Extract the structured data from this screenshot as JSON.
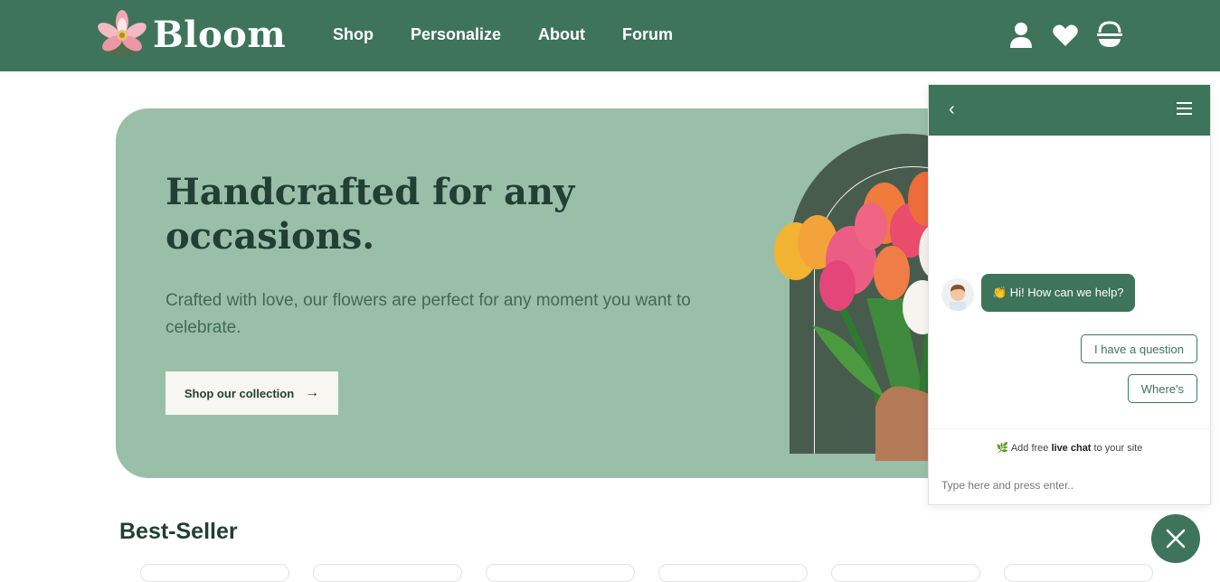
{
  "brand": {
    "name": "Bloom"
  },
  "nav": {
    "items": [
      "Shop",
      "Personalize",
      "About",
      "Forum"
    ]
  },
  "nav_icons": [
    "user-icon",
    "heart-icon",
    "basket-icon"
  ],
  "hero": {
    "title": "Handcrafted for any occasions.",
    "subtitle": "Crafted with love, our flowers are perfect for any moment you want to celebrate.",
    "cta_label": "Shop our collection",
    "cta_icon": "arrow-right-icon"
  },
  "best_seller": {
    "title": "Best-Seller"
  },
  "chat": {
    "greeting": "👏 Hi! How can we help?",
    "quick_replies": [
      "I have a question",
      "Where's"
    ],
    "promo": {
      "prefix": "Add free ",
      "bold": "live chat",
      "suffix": " to your site"
    },
    "input_placeholder": "Type here and press enter.."
  },
  "colors": {
    "primary": "#3e745b",
    "hero_bg": "#9abfa9",
    "heading": "#213f33",
    "cta_bg": "#f8f6f0"
  }
}
